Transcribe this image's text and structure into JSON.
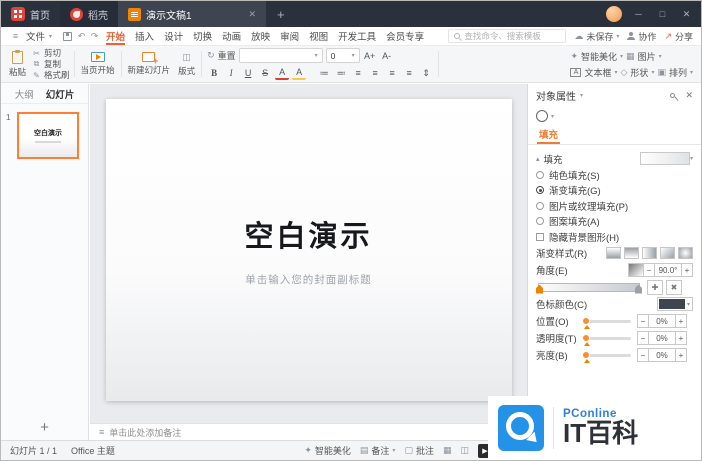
{
  "titlebar": {
    "home": "首页",
    "docer_tab": "稻壳",
    "document_tab": "演示文稿1",
    "new_tab": "+",
    "minimize": "─",
    "maximize": "□",
    "close": "✕"
  },
  "menubar": {
    "file": "文件",
    "tabs": [
      "开始",
      "插入",
      "设计",
      "切换",
      "动画",
      "放映",
      "审阅",
      "视图",
      "开发工具",
      "会员专享"
    ],
    "active_tab": "开始",
    "search_placeholder": "查找命令、搜索模板",
    "unsaved": "未保存",
    "collaborate": "协作",
    "share": "分享"
  },
  "ribbon": {
    "paste": "粘贴",
    "cut": "剪切",
    "copy": "复制",
    "format_painter": "格式刷",
    "play_current": "当页开始",
    "new_slide": "新建幻灯片",
    "layout": "版式",
    "reset": "重置",
    "font_name": "",
    "font_size": "0",
    "format_buttons": [
      "B",
      "I",
      "U",
      "S",
      "A",
      "A"
    ],
    "beautify": "智能美化",
    "picture": "图片",
    "textbox": "文本框",
    "shapes": "形状",
    "arrange": "排列"
  },
  "slides_panel": {
    "tab_outline": "大纲",
    "tab_slides": "幻灯片",
    "slide_number": "1",
    "add_slide": "+"
  },
  "slide": {
    "title": "空白演示",
    "subtitle": "单击输入您的封面副标题"
  },
  "notes": {
    "placeholder": "单击此处添加备注"
  },
  "properties": {
    "title": "对象属性",
    "tab": "填充",
    "section": "填充",
    "fill_options": [
      {
        "label": "纯色填充(S)",
        "selected": false
      },
      {
        "label": "渐变填充(G)",
        "selected": true
      },
      {
        "label": "图片或纹理填充(P)",
        "selected": false
      },
      {
        "label": "图案填充(A)",
        "selected": false
      },
      {
        "label": "隐藏背景图形(H)",
        "selected": false
      }
    ],
    "gradient_style": "渐变样式(R)",
    "angle": "角度(E)",
    "angle_value": "90.0°",
    "stop_color": "色标颜色(C)",
    "position": "位置(O)",
    "position_value": "0%",
    "transparency": "透明度(T)",
    "transparency_value": "0%",
    "brightness": "亮度(B)",
    "brightness_value": "0%"
  },
  "statusbar": {
    "slide_counter": "幻灯片 1 / 1",
    "theme": "Office 主题",
    "beautify": "智能美化",
    "notes": "备注",
    "comments": "批注"
  },
  "watermark": {
    "brand": "PConline",
    "title": "IT百科"
  },
  "icons": {
    "menu": "≡",
    "caret": "▾",
    "undo": "↶",
    "redo": "↷",
    "cut": "✂",
    "copy": "⧉",
    "painter": "✎",
    "reset": "↻",
    "layout": "◫",
    "bullets": "≔",
    "numbering": "≕",
    "align": "≡",
    "line_spacing": "⇕",
    "font_larger": "A+",
    "font_smaller": "A-",
    "beautify": "✦",
    "picture": "▦",
    "shape": "◇",
    "arrange": "▣",
    "textbox_letter": "A",
    "cloud": "☁",
    "share_arrow": "↗",
    "close": "✕",
    "play": "▶",
    "notes": "▤",
    "comment": "▢",
    "view_normal": "▦",
    "view_sorter": "◫",
    "add_stop": "✚",
    "remove_stop": "✖",
    "minus": "−",
    "plus": "+"
  },
  "colors": {
    "accent_orange": "#e8643c",
    "titlebar_bg": "#2b313c",
    "selection_orange": "#ff7e33",
    "watermark_blue": "#2492e6"
  }
}
